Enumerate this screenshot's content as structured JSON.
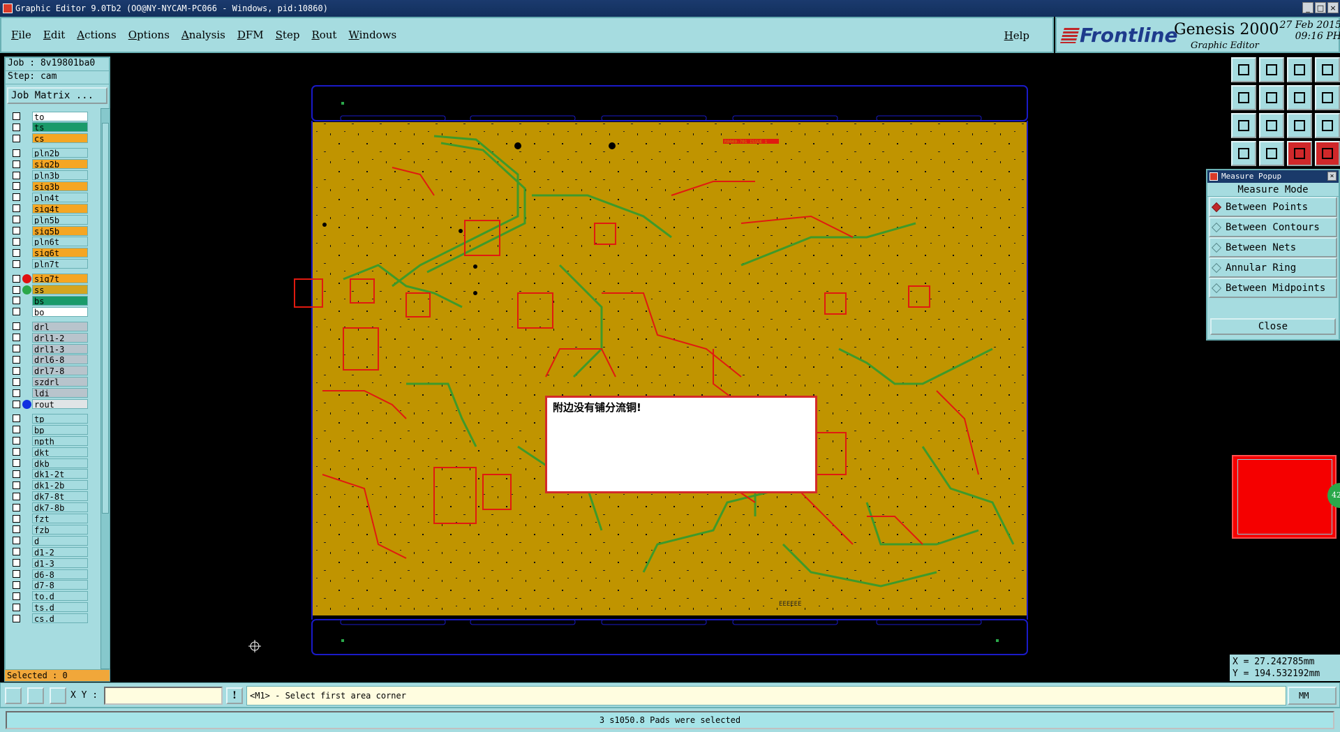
{
  "titlebar": {
    "text": "Graphic Editor 9.0Tb2 (OO@NY-NYCAM-PC066 - Windows, pid:10860)",
    "min": "_",
    "max": "□",
    "close": "×"
  },
  "menu": {
    "items": [
      "File",
      "Edit",
      "Actions",
      "Options",
      "Analysis",
      "DFM",
      "Step",
      "Rout",
      "Windows"
    ],
    "help": "Help"
  },
  "brand": {
    "logo": "Frontline",
    "product": "Genesis 2000",
    "subtitle": "Graphic Editor",
    "date": "27 Feb 2015",
    "time": "09:16 PH"
  },
  "job": {
    "job_line": "Job : 8v19801ba0",
    "step_line": "Step: cam",
    "matrix_button": "Job Matrix ..."
  },
  "layers": [
    {
      "name": "to",
      "bg": "#ffffff",
      "dot": "",
      "mark": "⬏"
    },
    {
      "name": "ts",
      "bg": "#1a9a6a",
      "dot": ""
    },
    {
      "name": "cs",
      "bg": "#f5a623",
      "dot": ""
    },
    {
      "name": "pln2b",
      "bg": "#a6dce0",
      "dot": ""
    },
    {
      "name": "sig2b",
      "bg": "#f5a623",
      "dot": ""
    },
    {
      "name": "pln3b",
      "bg": "#a6dce0",
      "dot": ""
    },
    {
      "name": "sig3b",
      "bg": "#f5a623",
      "dot": ""
    },
    {
      "name": "pln4t",
      "bg": "#a6dce0",
      "dot": ""
    },
    {
      "name": "sig4t",
      "bg": "#f5a623",
      "dot": ""
    },
    {
      "name": "pln5b",
      "bg": "#a6dce0",
      "dot": ""
    },
    {
      "name": "sig5b",
      "bg": "#f5a623",
      "dot": ""
    },
    {
      "name": "pln6t",
      "bg": "#a6dce0",
      "dot": ""
    },
    {
      "name": "sig6t",
      "bg": "#f5a623",
      "dot": ""
    },
    {
      "name": "pln7t",
      "bg": "#a6dce0",
      "dot": ""
    },
    {
      "name": "sig7t",
      "bg": "#f5a623",
      "dot": "#e01010"
    },
    {
      "name": "ss",
      "bg": "#d4a520",
      "dot": "#2aa84a"
    },
    {
      "name": "bs",
      "bg": "#1a9a6a",
      "dot": ""
    },
    {
      "name": "bo",
      "bg": "#ffffff",
      "dot": "",
      "mark": "⬏"
    },
    {
      "name": "drl",
      "bg": "#b8c4cc",
      "dot": ""
    },
    {
      "name": "drl1-2",
      "bg": "#b8c4cc",
      "dot": ""
    },
    {
      "name": "drl1-3",
      "bg": "#b8c4cc",
      "dot": ""
    },
    {
      "name": "drl6-8",
      "bg": "#b8c4cc",
      "dot": ""
    },
    {
      "name": "drl7-8",
      "bg": "#b8c4cc",
      "dot": ""
    },
    {
      "name": "szdrl",
      "bg": "#b8c4cc",
      "dot": ""
    },
    {
      "name": "ldi",
      "bg": "#b8c4cc",
      "dot": ""
    },
    {
      "name": "rout",
      "bg": "#e0e4e6",
      "dot": "#1030e0"
    },
    {
      "name": "tp",
      "bg": "#a6dce0",
      "dot": ""
    },
    {
      "name": "bp",
      "bg": "#a6dce0",
      "dot": ""
    },
    {
      "name": "npth",
      "bg": "#a6dce0",
      "dot": ""
    },
    {
      "name": "dkt",
      "bg": "#a6dce0",
      "dot": ""
    },
    {
      "name": "dkb",
      "bg": "#a6dce0",
      "dot": ""
    },
    {
      "name": "dk1-2t",
      "bg": "#a6dce0",
      "dot": ""
    },
    {
      "name": "dk1-2b",
      "bg": "#a6dce0",
      "dot": ""
    },
    {
      "name": "dk7-8t",
      "bg": "#a6dce0",
      "dot": ""
    },
    {
      "name": "dk7-8b",
      "bg": "#a6dce0",
      "dot": ""
    },
    {
      "name": "fzt",
      "bg": "#a6dce0",
      "dot": ""
    },
    {
      "name": "fzb",
      "bg": "#a6dce0",
      "dot": ""
    },
    {
      "name": "d",
      "bg": "#a6dce0",
      "dot": ""
    },
    {
      "name": "d1-2",
      "bg": "#a6dce0",
      "dot": ""
    },
    {
      "name": "d1-3",
      "bg": "#a6dce0",
      "dot": ""
    },
    {
      "name": "d6-8",
      "bg": "#a6dce0",
      "dot": ""
    },
    {
      "name": "d7-8",
      "bg": "#a6dce0",
      "dot": ""
    },
    {
      "name": "to.d",
      "bg": "#a6dce0",
      "dot": "",
      "mark": "⬏"
    },
    {
      "name": "ts.d",
      "bg": "#a6dce0",
      "dot": ""
    },
    {
      "name": "cs.d",
      "bg": "#a6dce0",
      "dot": ""
    }
  ],
  "selected": "Selected : 0",
  "canvas": {
    "message": "附边没有铺分流铜!",
    "board_label": "R0000-701 ISSUE 1",
    "corner_text": "EEEEEE"
  },
  "measure": {
    "title": "Measure Popup",
    "mode_label": "Measure Mode",
    "options": [
      "Between Points",
      "Between Contours",
      "Between Nets",
      "Annular Ring",
      "Between Midpoints"
    ],
    "selected": "Between Points",
    "close": "Close"
  },
  "overview": {
    "badge": "42"
  },
  "coords": {
    "x": "X = 27.242785mm",
    "y": "Y = 194.532192mm"
  },
  "bottom": {
    "xy_label": "X Y :",
    "xy_value": "",
    "excl": "!",
    "prompt": "<M1> - Select first area corner",
    "unit": "MM"
  },
  "status": "3 s1050.8 Pads were selected",
  "colors": {
    "panel": "#a6dce0",
    "board": "#c09400",
    "trace_red": "#e01a10",
    "trace_green": "#3e9a2a",
    "outline_blue": "#1a1ac8"
  }
}
